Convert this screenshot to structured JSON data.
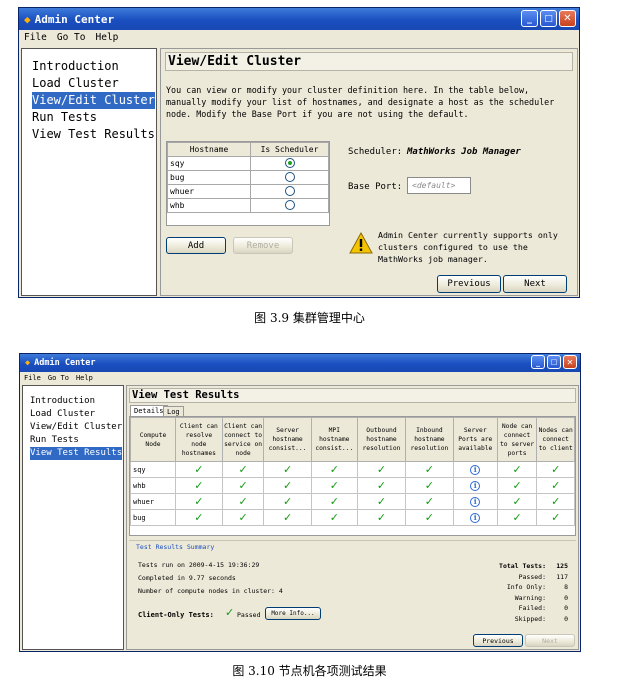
{
  "window1": {
    "title": "Admin Center",
    "menu": [
      "File",
      "Go To",
      "Help"
    ],
    "nav": [
      "Introduction",
      "Load Cluster",
      "View/Edit Cluster",
      "Run Tests",
      "View Test Results"
    ],
    "nav_selected": "View/Edit Cluster",
    "heading": "View/Edit Cluster",
    "description": "You can view or modify your cluster definition here. In the table below, manually modify your list of hostnames, and designate a host as the scheduler node. Modify the Base Port if you are not using the default.",
    "table": {
      "columns": [
        "Hostname",
        "Is Scheduler"
      ],
      "rows": [
        {
          "hostname": "sqy",
          "is_scheduler": true
        },
        {
          "hostname": "bug",
          "is_scheduler": false
        },
        {
          "hostname": "whuer",
          "is_scheduler": false
        },
        {
          "hostname": "whb",
          "is_scheduler": false
        }
      ]
    },
    "add_button": "Add",
    "remove_button": "Remove",
    "scheduler_label": "Scheduler:",
    "scheduler_value": "MathWorks Job Manager",
    "base_port_label": "Base Port:",
    "base_port_placeholder": "<default>",
    "warning_text": "Admin Center currently supports only clusters configured to use the MathWorks job manager.",
    "previous_button": "Previous",
    "next_button": "Next"
  },
  "caption1": "图 3.9  集群管理中心",
  "window2": {
    "title": "Admin Center",
    "menu": [
      "File",
      "Go To",
      "Help"
    ],
    "nav": [
      "Introduction",
      "Load Cluster",
      "View/Edit Cluster",
      "Run Tests",
      "View Test Results"
    ],
    "nav_selected": "View Test Results",
    "heading": "View Test Results",
    "tabs": [
      "Details",
      "Log"
    ],
    "active_tab": "Details",
    "columns": [
      "Compute Node",
      "Client can resolve node hostnames",
      "Client can connect to service on node",
      "Server hostname consist...",
      "MPI hostname consist...",
      "Outbound hostname resolution",
      "Inbound hostname resolution",
      "Server Ports are available",
      "Node can connect to server ports",
      "Nodes can connect to client"
    ],
    "rows": [
      {
        "node": "sqy",
        "results": [
          "check",
          "check",
          "check",
          "check",
          "check",
          "check",
          "info",
          "check",
          "check"
        ]
      },
      {
        "node": "whb",
        "results": [
          "check",
          "check",
          "check",
          "check",
          "check",
          "check",
          "info",
          "check",
          "check"
        ]
      },
      {
        "node": "whuer",
        "results": [
          "check",
          "check",
          "check",
          "check",
          "check",
          "check",
          "info",
          "check",
          "check"
        ]
      },
      {
        "node": "bug",
        "results": [
          "check",
          "check",
          "check",
          "check",
          "check",
          "check",
          "info",
          "check",
          "check"
        ]
      }
    ],
    "summary_title": "Test Results Summary",
    "tests_run": "Tests run on 2009-4-15 19:36:29",
    "completed_in": "Completed in 9.77 seconds",
    "node_count": "Number of compute nodes in cluster: 4",
    "client_only_label": "Client-Only Tests:",
    "client_only_status": "Passed",
    "more_info_button": "More Info...",
    "totals": [
      {
        "label": "Total Tests:",
        "value": "125"
      },
      {
        "label": "Passed:",
        "value": "117"
      },
      {
        "label": "Info Only:",
        "value": "8"
      },
      {
        "label": "Warning:",
        "value": "0"
      },
      {
        "label": "Failed:",
        "value": "0"
      },
      {
        "label": "Skipped:",
        "value": "0"
      }
    ],
    "previous_button": "Previous",
    "next_button": "Next"
  },
  "caption2": "图 3.10  节点机各项测试结果",
  "colors": {
    "titlebar": "#1a4fc0",
    "selection": "#316ac5",
    "check": "#139a13",
    "info": "#2e6ad1"
  }
}
